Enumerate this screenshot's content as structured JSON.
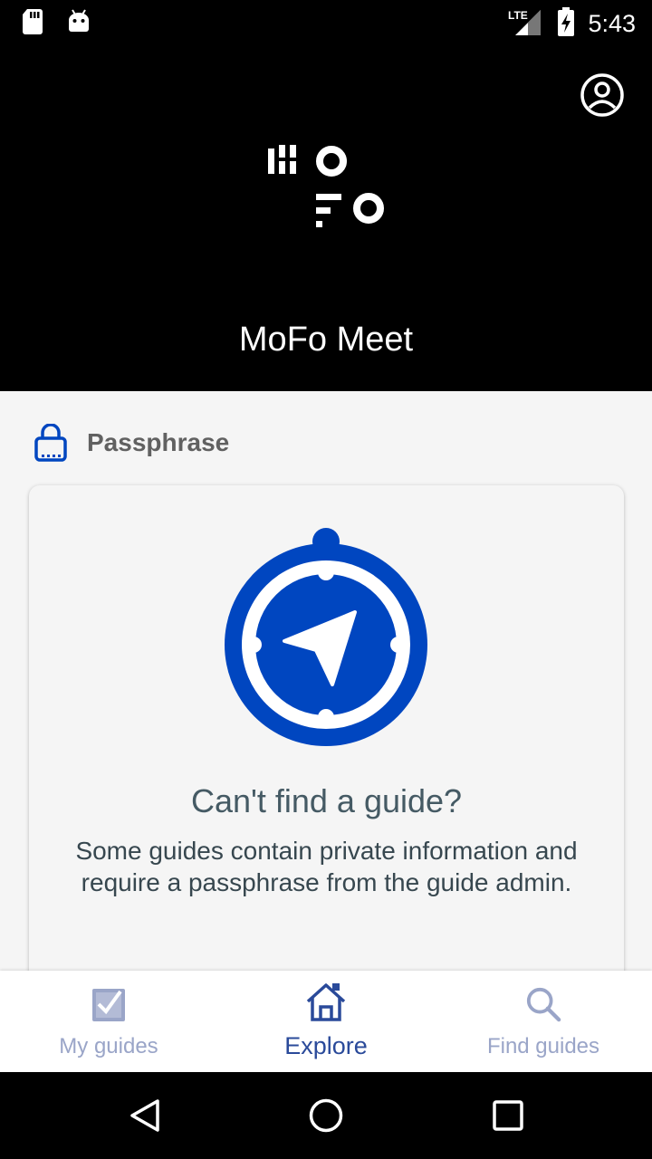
{
  "status_bar": {
    "time": "5:43",
    "network": "LTE",
    "icons": [
      "sd-card-icon",
      "android-icon",
      "signal-icon",
      "battery-charging-icon"
    ]
  },
  "header": {
    "logo_text": "MoFo",
    "title": "MoFo Meet",
    "profile_icon": "account-circle-icon"
  },
  "passphrase": {
    "label": "Passphrase",
    "icon": "lock-icon"
  },
  "card": {
    "icon": "compass-icon",
    "title": "Can't find a guide?",
    "text": "Some guides contain private information and require a passphrase from the guide admin."
  },
  "bottom_nav": {
    "items": [
      {
        "label": "My guides",
        "icon": "checkbox-icon",
        "active": false
      },
      {
        "label": "Explore",
        "icon": "home-icon",
        "active": true
      },
      {
        "label": "Find guides",
        "icon": "search-icon",
        "active": false
      }
    ]
  },
  "colors": {
    "brand_blue": "#0046c0",
    "header_bg": "#000000",
    "content_bg": "#f5f5f5",
    "nav_active": "#2a4a9a",
    "nav_inactive": "#9aa5c8"
  }
}
